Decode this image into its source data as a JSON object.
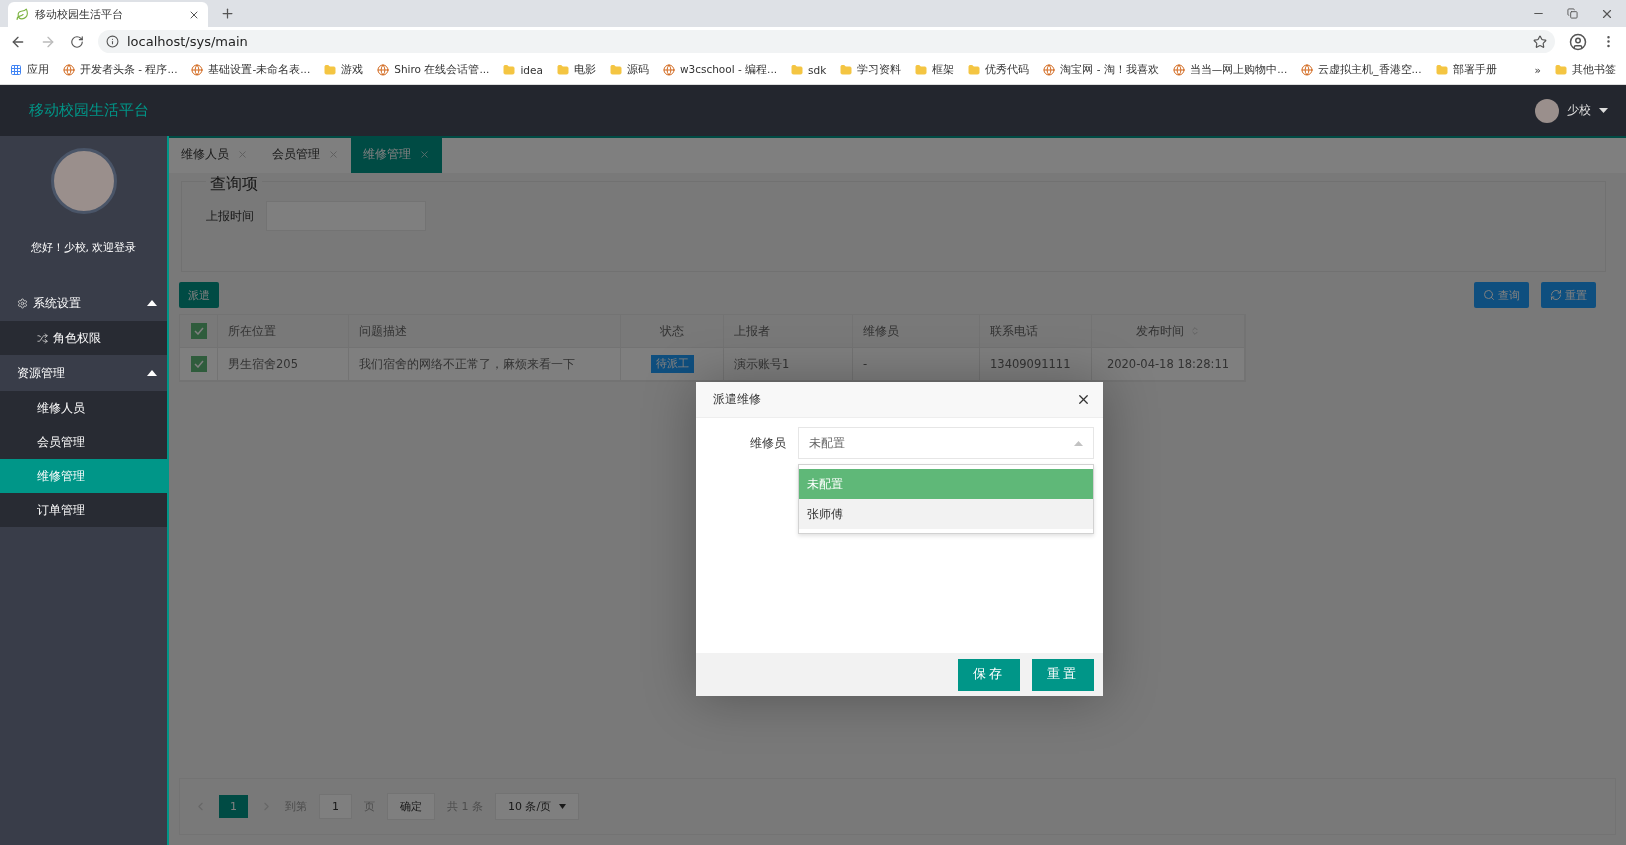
{
  "browser": {
    "tab_title": "移动校园生活平台",
    "url": "localhost/sys/main",
    "bookmarks": [
      {
        "kind": "apps",
        "label": "应用"
      },
      {
        "kind": "site",
        "label": "开发者头条 - 程序..."
      },
      {
        "kind": "site",
        "label": "基础设置-未命名表..."
      },
      {
        "kind": "folder",
        "label": "游戏"
      },
      {
        "kind": "site",
        "label": "Shiro 在线会话管..."
      },
      {
        "kind": "folder",
        "label": "idea"
      },
      {
        "kind": "folder",
        "label": "电影"
      },
      {
        "kind": "folder",
        "label": "源码"
      },
      {
        "kind": "site",
        "label": "w3cschool - 编程..."
      },
      {
        "kind": "folder",
        "label": "sdk"
      },
      {
        "kind": "folder",
        "label": "学习资料"
      },
      {
        "kind": "folder",
        "label": "框架"
      },
      {
        "kind": "folder",
        "label": "优秀代码"
      },
      {
        "kind": "site",
        "label": "淘宝网 - 淘！我喜欢"
      },
      {
        "kind": "site",
        "label": "当当—网上购物中..."
      },
      {
        "kind": "site",
        "label": "云虚拟主机_香港空..."
      },
      {
        "kind": "folder",
        "label": "部署手册"
      }
    ],
    "more": "»",
    "other_bookmarks": "其他书签"
  },
  "header": {
    "title": "移动校园生活平台",
    "user": "少校"
  },
  "sidebar": {
    "greeting": "您好！少校, 欢迎登录",
    "groups": [
      {
        "label": "系统设置",
        "expanded": true,
        "children": [
          {
            "label": "角色权限",
            "selected": false
          }
        ]
      },
      {
        "label": "资源管理",
        "expanded": true,
        "children": [
          {
            "label": "维修人员",
            "selected": false
          },
          {
            "label": "会员管理",
            "selected": false
          },
          {
            "label": "维修管理",
            "selected": true
          },
          {
            "label": "订单管理",
            "selected": false
          }
        ]
      }
    ]
  },
  "tabs": [
    {
      "label": "维修人员",
      "selected": false
    },
    {
      "label": "会员管理",
      "selected": false
    },
    {
      "label": "维修管理",
      "selected": true
    }
  ],
  "query": {
    "legend": "查询项",
    "field_label": "上报时间"
  },
  "toolbar": {
    "dispatch": "派遣",
    "search": "查询",
    "reset": "重置"
  },
  "table": {
    "columns": [
      {
        "label": "所在位置",
        "sortable": false
      },
      {
        "label": "问题描述",
        "sortable": false
      },
      {
        "label": "状态",
        "sortable": false
      },
      {
        "label": "上报者",
        "sortable": false
      },
      {
        "label": "维修员",
        "sortable": false
      },
      {
        "label": "联系电话",
        "sortable": false
      },
      {
        "label": "发布时间",
        "sortable": true
      }
    ],
    "header_checked": true,
    "rows": [
      {
        "checked": true,
        "cells": [
          {
            "kind": "text",
            "text": "男生宿舍205"
          },
          {
            "kind": "text",
            "text": "我们宿舍的网络不正常了，麻烦来看一下"
          },
          {
            "kind": "badge",
            "text": "待派工"
          },
          {
            "kind": "text",
            "text": "演示账号1"
          },
          {
            "kind": "text",
            "text": "-"
          },
          {
            "kind": "text",
            "text": "13409091111"
          },
          {
            "kind": "text",
            "text": "2020-04-18 18:28:11"
          }
        ]
      }
    ]
  },
  "pagination": {
    "pages": [
      {
        "label": "1",
        "selected": true
      }
    ],
    "goto": "到第",
    "page_value": "1",
    "page_unit": "页",
    "confirm": "确定",
    "total": "共 1 条",
    "page_size": "10 条/页"
  },
  "dialog": {
    "title": "派遣维修",
    "field_label": "维修员",
    "value": "未配置",
    "options": [
      {
        "label": "未配置",
        "selected": true,
        "hovered": false
      },
      {
        "label": "张师傅",
        "selected": false,
        "hovered": true
      }
    ],
    "save": "保存",
    "reset": "重置"
  }
}
